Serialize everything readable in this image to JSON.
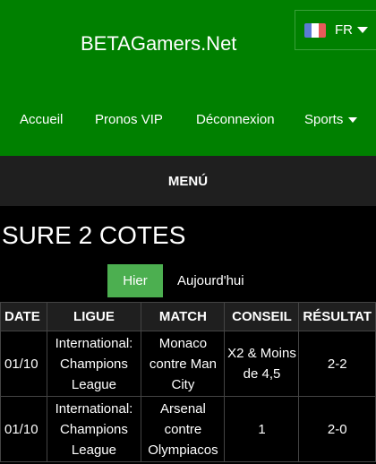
{
  "header": {
    "brand": "BETAGamers.Net",
    "language": {
      "code": "FR",
      "flag_colors": [
        "#5b7bd5",
        "#ffffff",
        "#e85a5a"
      ]
    }
  },
  "nav": {
    "items": [
      {
        "label": "Accueil"
      },
      {
        "label": "Pronos VIP"
      },
      {
        "label": "Déconnexion"
      },
      {
        "label": "Sports"
      }
    ]
  },
  "menu": {
    "label": "MENÚ"
  },
  "page": {
    "title": "SURE 2 COTES"
  },
  "day_tabs": {
    "yesterday": "Hier",
    "today": "Aujourd'hui"
  },
  "table": {
    "headers": [
      "DATE",
      "LIGUE",
      "MATCH",
      "CONSEIL",
      "RÉSULTAT"
    ],
    "rows": [
      {
        "date": "01/10",
        "league": "International: Champions League",
        "match": "Monaco contre Man City",
        "advice": "X2 & Moins de 4,5",
        "result": "2-2"
      },
      {
        "date": "01/10",
        "league": "International: Champions League",
        "match": "Arsenal contre Olympiacos",
        "advice": "1",
        "result": "2-0"
      }
    ]
  },
  "colors": {
    "header_bg": "#008000",
    "menubar_bg": "#1f1f1f",
    "active_tab": "#4caf50",
    "page_bg": "#000000"
  }
}
